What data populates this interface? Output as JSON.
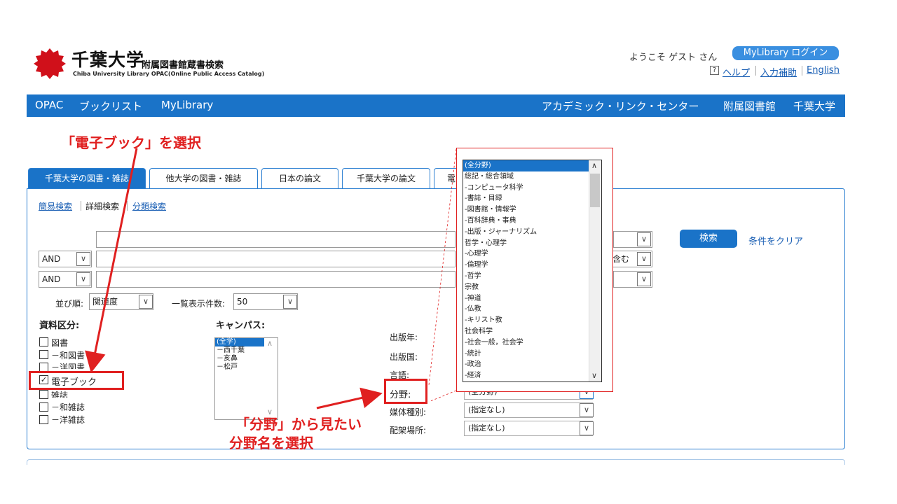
{
  "header": {
    "university": "千葉大学",
    "system_title": "附属図書館蔵書検索",
    "english_title": "Chiba University Library OPAC(Online Public Access Catalog)",
    "welcome": "ようこそ ゲスト さん",
    "login_button": "MyLibrary ログイン",
    "help_icon": "?",
    "help": "ヘルプ",
    "input_assist": "入力補助",
    "english": "English"
  },
  "nav": {
    "left": [
      "OPAC",
      "ブックリスト",
      "MyLibrary"
    ],
    "right": [
      "アカデミック・リンク・センター",
      "附属図書館",
      "千葉大学"
    ]
  },
  "tabs": [
    "千葉大学の図書・雑誌",
    "他大学の図書・雑誌",
    "日本の論文",
    "千葉大学の論文",
    "電子"
  ],
  "subtabs": {
    "simple": "簡易検索",
    "advanced": "詳細検索",
    "classified": "分類検索"
  },
  "search": {
    "bool1": "AND",
    "bool2": "AND",
    "contains": "を含む",
    "search_button": "検索",
    "clear": "条件をクリア",
    "sort_label": "並び順:",
    "sort_value": "関連度",
    "count_label": "一覧表示件数:",
    "count_value": "50"
  },
  "material": {
    "label": "資料区分:",
    "items": [
      "図書",
      "－和図書",
      "－洋図書",
      "電子ブック",
      "雑誌",
      "－和雑誌",
      "－洋雑誌"
    ]
  },
  "campus": {
    "label": "キャンパス:",
    "items": [
      "(全学)",
      "－西千葉",
      "－亥鼻",
      "－松戸"
    ]
  },
  "fields": {
    "pub_year": "出版年:",
    "pub_country": "出版国:",
    "language": "言語:",
    "subject": "分野:",
    "subject_value": "(全分野)",
    "media": "媒体種別:",
    "media_value": "(指定なし)",
    "location": "配架場所:",
    "location_value": "(指定なし)"
  },
  "subject_dropdown": [
    "(全分野)",
    "総記・総合領域",
    "-コンピュータ科学",
    "-書誌・目録",
    "-図書館・情報学",
    "-百科辞典・事典",
    "-出版・ジャーナリズム",
    "哲学・心理学",
    "-心理学",
    "-倫理学",
    "-哲学",
    "宗教",
    "-神道",
    "-仏教",
    "-キリスト教",
    "社会科学",
    "-社会一般，社会学",
    "-統計",
    "-政治",
    "-経済"
  ],
  "annotations": {
    "select_ebook": "「電子ブック」を選択",
    "select_subject_line1": "「分野」から見たい",
    "select_subject_line2": "分野名を選択"
  },
  "colors": {
    "accent": "#1a73c8",
    "annotation": "#e02020",
    "logo": "#d0101a"
  }
}
